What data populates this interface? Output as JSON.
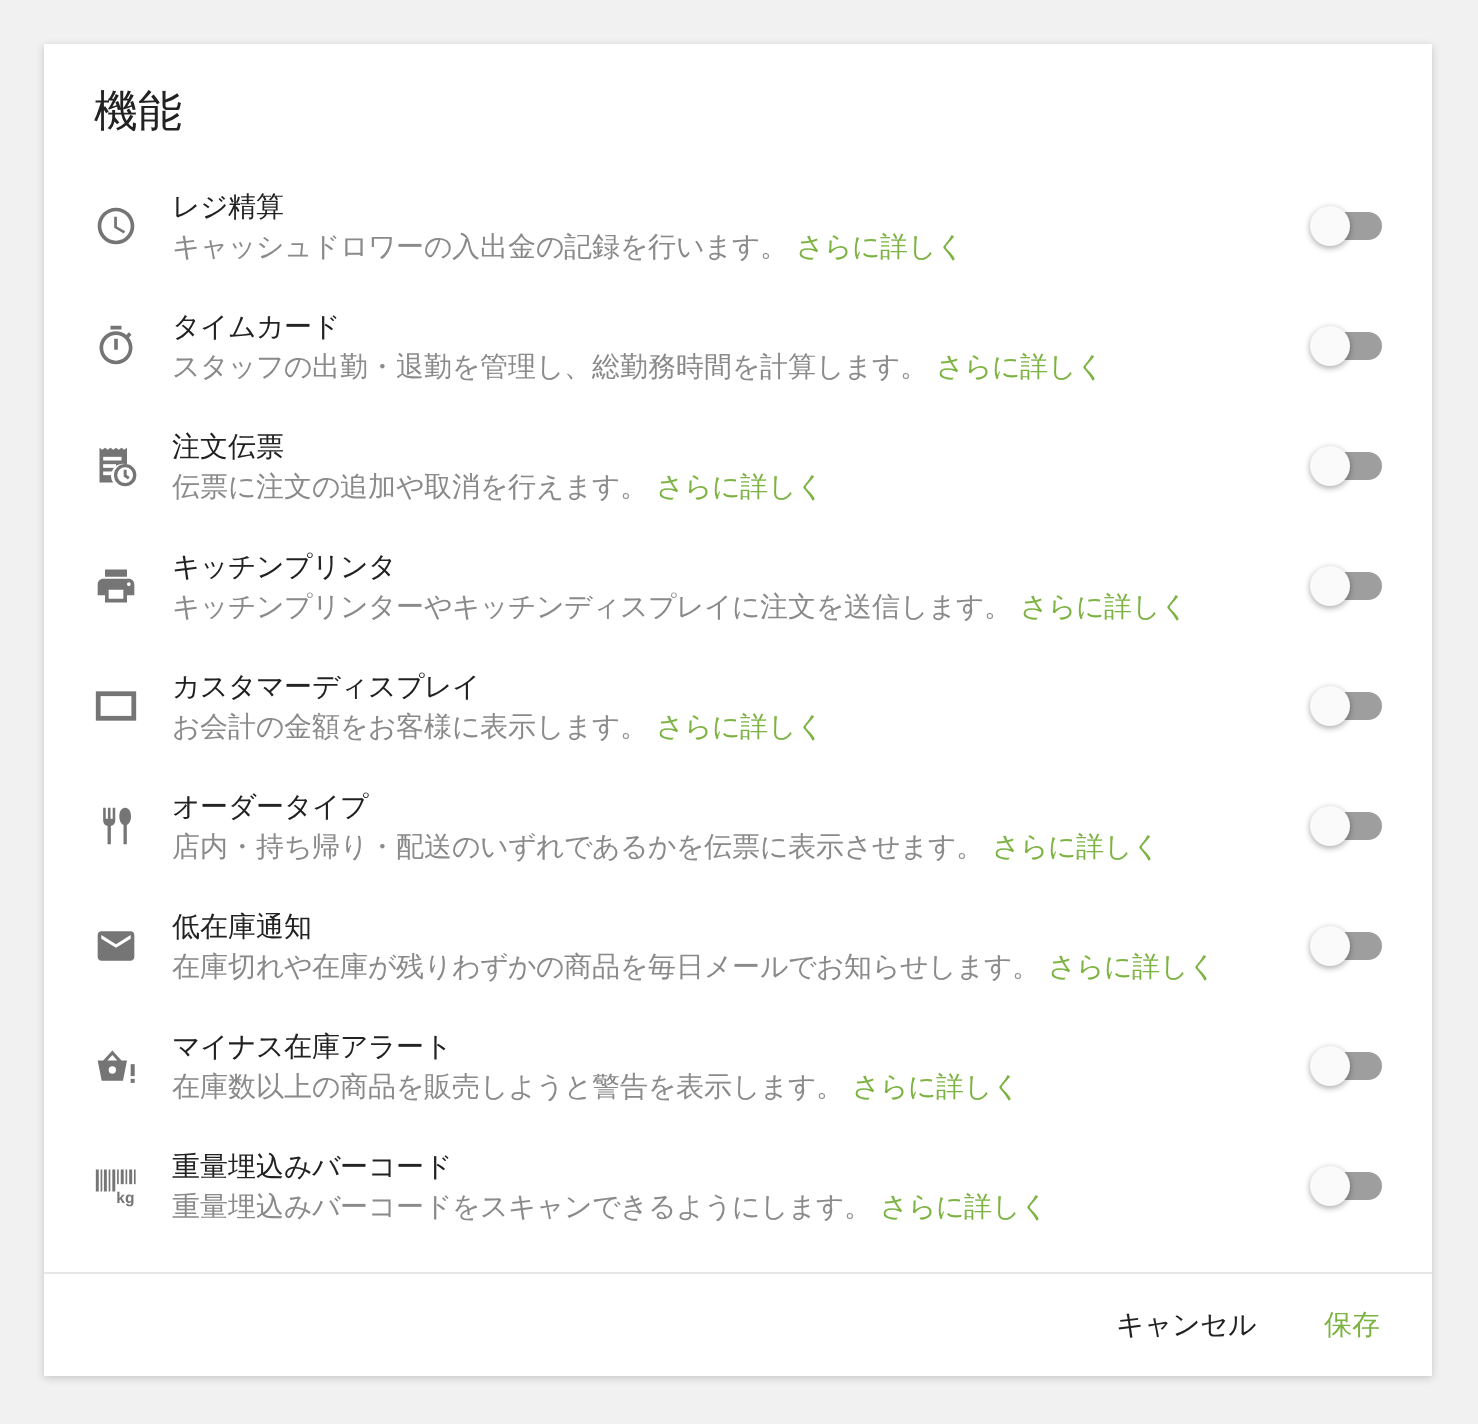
{
  "panel": {
    "title": "機能"
  },
  "features": [
    {
      "name": "レジ精算",
      "description": "キャッシュドロワーの入出金の記録を行います。",
      "link": "さらに詳しく",
      "on": false
    },
    {
      "name": "タイムカード",
      "description": "スタッフの出勤・退勤を管理し、総勤務時間を計算します。",
      "link": "さらに詳しく",
      "on": false
    },
    {
      "name": "注文伝票",
      "description": "伝票に注文の追加や取消を行えます。",
      "link": "さらに詳しく",
      "on": false
    },
    {
      "name": "キッチンプリンタ",
      "description": "キッチンプリンターやキッチンディスプレイに注文を送信します。",
      "link": "さらに詳しく",
      "on": false
    },
    {
      "name": "カスタマーディスプレイ",
      "description": "お会計の金額をお客様に表示します。",
      "link": "さらに詳しく",
      "on": false
    },
    {
      "name": "オーダータイプ",
      "description": "店内・持ち帰り・配送のいずれであるかを伝票に表示させます。",
      "link": "さらに詳しく",
      "on": false
    },
    {
      "name": "低在庫通知",
      "description": "在庫切れや在庫が残りわずかの商品を毎日メールでお知らせします。",
      "link": "さらに詳しく",
      "on": false
    },
    {
      "name": "マイナス在庫アラート",
      "description": "在庫数以上の商品を販売しようと警告を表示します。",
      "link": "さらに詳しく",
      "on": false
    },
    {
      "name": "重量埋込みバーコード",
      "description": "重量埋込みバーコードをスキャンできるようにします。",
      "link": "さらに詳しく",
      "on": false,
      "icon_label": "kg"
    }
  ],
  "footer": {
    "buttons": [
      {
        "label": "キャンセル",
        "kind": "secondary"
      },
      {
        "label": "保存",
        "kind": "primary"
      }
    ]
  }
}
